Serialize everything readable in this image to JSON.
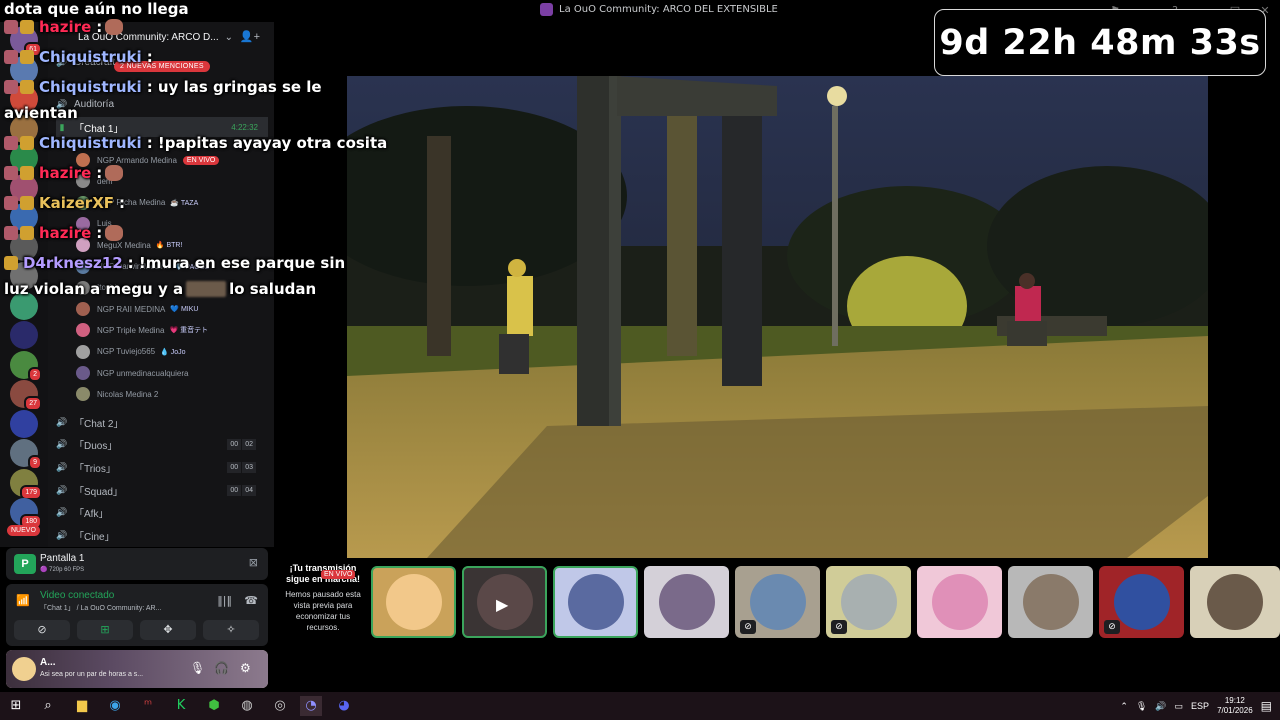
{
  "window": {
    "title": "La OuO Community: ARCO DEL EXTENSIBLE"
  },
  "timer": {
    "text": "9d 22h 48m 33s"
  },
  "overlay_chat": [
    {
      "user": "",
      "text": "dota que aún no llega",
      "icons": []
    },
    {
      "user": "hazire",
      "text": ":",
      "icons": [
        "mod",
        "sub"
      ],
      "class": "u-hazire",
      "emote": true
    },
    {
      "user": "Chiquistruki",
      "text": ":",
      "icons": [
        "mod",
        "sub"
      ],
      "class": "u-chiqui"
    },
    {
      "user": "Chiquistruki",
      "text": ": uy las gringas se le",
      "icons": [
        "mod",
        "sub"
      ],
      "class": "u-chiqui"
    },
    {
      "user": "",
      "text": "avientan",
      "icons": []
    },
    {
      "user": "Chiquistruki",
      "text": ": !papitas ayayay otra cosita",
      "icons": [
        "mod",
        "sub"
      ],
      "class": "u-chiqui"
    },
    {
      "user": "hazire",
      "text": ":",
      "icons": [
        "mod",
        "sub"
      ],
      "class": "u-hazire",
      "emote": true
    },
    {
      "user": "KaizerXF",
      "text": ":",
      "icons": [
        "mod",
        "sub"
      ],
      "class": "u-kaizer"
    },
    {
      "user": "hazire",
      "text": ":",
      "icons": [
        "mod",
        "sub"
      ],
      "class": "u-hazire",
      "emote": true
    },
    {
      "user": "D4rknesz12",
      "text": ": !mura en ese parque sin",
      "icons": [
        "sub"
      ],
      "class": "u-d4rk"
    },
    {
      "user": "",
      "text": "luz violan a megu y a",
      "icons": [],
      "blur": true,
      "after": " lo saludan"
    }
  ],
  "server": {
    "name": "La OuO Community: ARCO D...",
    "mentions": "2 NUEVAS MENCIONES",
    "new_badge": "NUEVO"
  },
  "rail_badges": [
    "61",
    "",
    "",
    "",
    "",
    "",
    "",
    "",
    "",
    "",
    "",
    "2",
    "27",
    "",
    "9",
    "179",
    "180"
  ],
  "channels": {
    "creacraft": "Creacraft",
    "auditoria": "Auditoría",
    "chat1": "「Chat 1」",
    "chat1_time": "4:22:32",
    "chat2": "「Chat 2」",
    "duos": "「Duos」",
    "trios": "「Trios」",
    "squad": "「Squad」",
    "afk": "「Afk」",
    "cine": "「Cine」",
    "duos_cnt": [
      "00",
      "02"
    ],
    "trios_cnt": [
      "00",
      "03"
    ],
    "squad_cnt": [
      "00",
      "04"
    ]
  },
  "voice_users": [
    {
      "name": "NGP Armando Medina",
      "tag": "",
      "live": "EN VIVO"
    },
    {
      "name": "dem",
      "tag": ""
    },
    {
      "name": "NGP Richa Medina",
      "tag": "☕ TAZA"
    },
    {
      "name": "Luis",
      "tag": ""
    },
    {
      "name": "MeguX Medina",
      "tag": "🔥 BTR!"
    },
    {
      "name": "NGP Darwin Medina",
      "tag": "💎 PACOS"
    },
    {
      "name": "Itoshi",
      "tag": ""
    },
    {
      "name": "NGP RAII MEDINA",
      "tag": "💙 MIKU"
    },
    {
      "name": "NGP Triple Medina",
      "tag": "💗 重音テト"
    },
    {
      "name": "NGP Tuviejo565",
      "tag": "💧 JoJo"
    },
    {
      "name": "NGP unmedinacualquiera",
      "tag": ""
    },
    {
      "name": "Nicolas Medina 2",
      "tag": ""
    }
  ],
  "screen_share": {
    "title": "Pantalla 1",
    "sub": "🟣 720p 60 FPS"
  },
  "voice": {
    "status": "Video conectado",
    "sub": "「Chat 1」 / La OuO Community: AR..."
  },
  "user": {
    "name": "A...",
    "status": "Asi sea por un par de horas a s..."
  },
  "notice": {
    "heading": "¡Tu transmisión sigue en marcha!",
    "live": "EN VIVO",
    "paused": "Hemos pausado esta vista previa para economizar tus recursos."
  },
  "taskbar": {
    "lang": "ESP",
    "time": "19:12",
    "date": "7/01/2026"
  },
  "colors": {
    "accent_green": "#23a55a",
    "danger_red": "#da373c",
    "timer_bg": "#000000"
  }
}
